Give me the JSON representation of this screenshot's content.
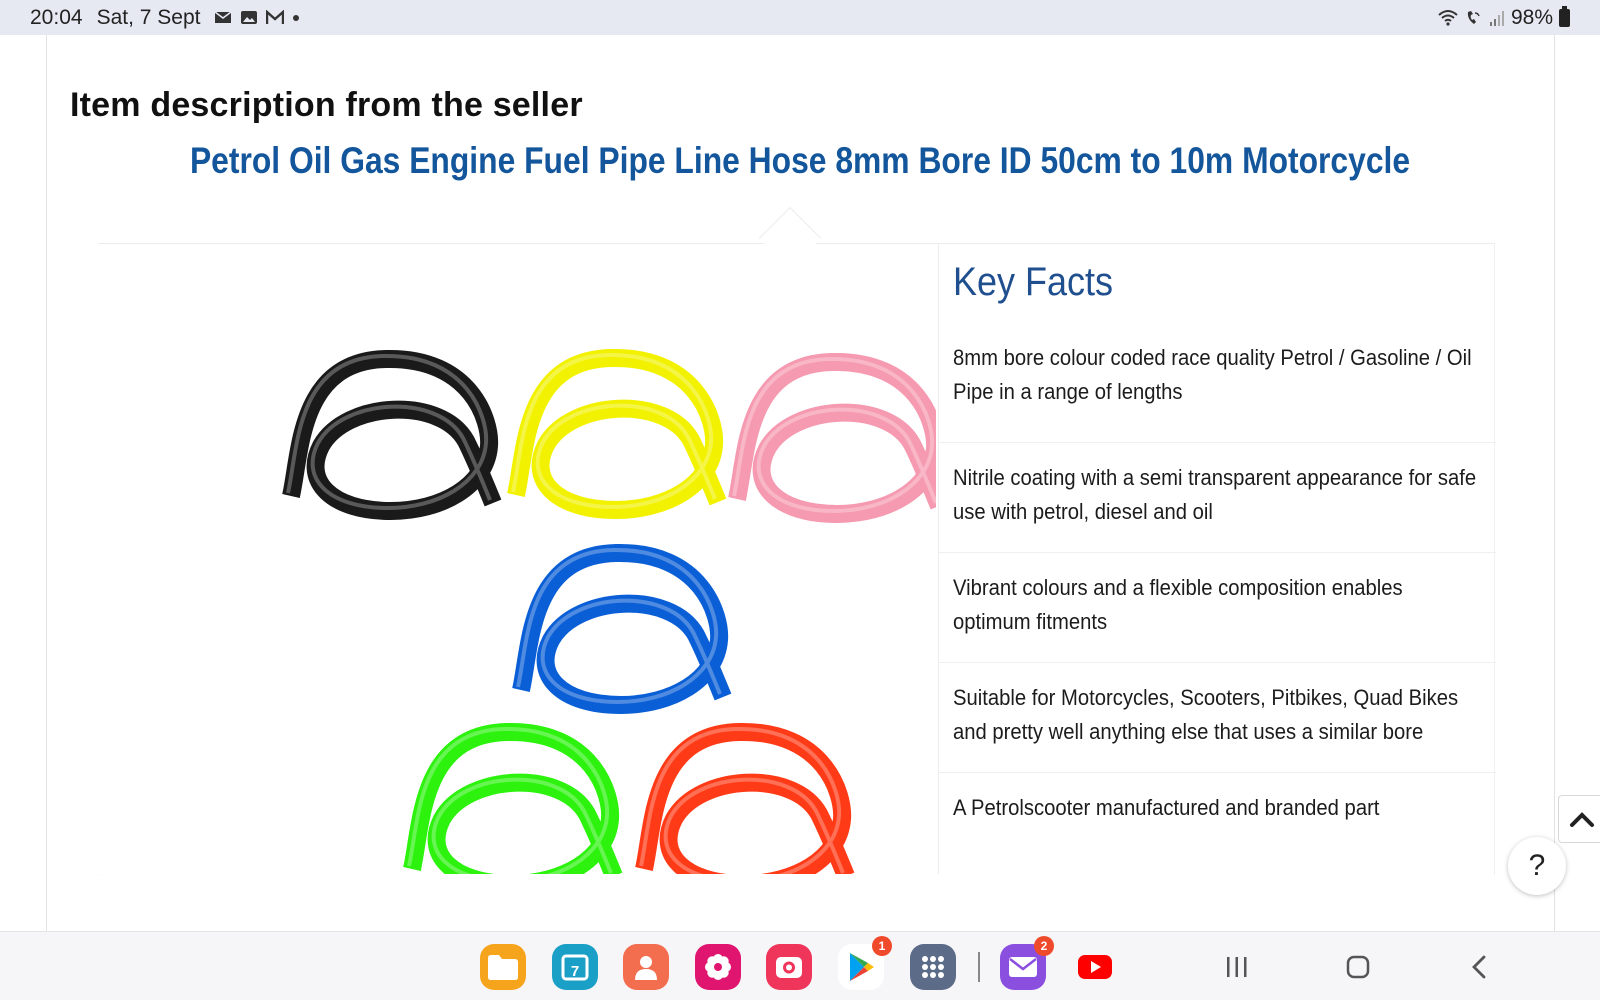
{
  "status_bar": {
    "time": "20:04",
    "date": "Sat, 7 Sept",
    "notification_icons": [
      "email-icon",
      "image-icon",
      "gmail-icon",
      "dot-icon"
    ],
    "battery": "98%",
    "system_icons": [
      "wifi-icon",
      "wifi-call-icon",
      "signal-icon",
      "battery-icon"
    ]
  },
  "page": {
    "section_heading": "Item description from the seller",
    "product_title": "Petrol Oil Gas Engine Fuel Pipe Line Hose 8mm Bore ID 50cm to 10m Motorcycle",
    "product_image": {
      "hose_colors": [
        "#1a1a1a",
        "#f2f200",
        "#f59ab0",
        "#0b5fd6",
        "#2cf20e",
        "#ff3a17"
      ]
    },
    "key_facts": {
      "title": "Key Facts",
      "items": [
        "8mm bore colour coded race quality Petrol / Gasoline / Oil Pipe in a range of lengths",
        "Nitrile coating with a semi transparent appearance for safe use with petrol, diesel and oil",
        "Vibrant colours and a flexible composition enables optimum fitments",
        "Suitable for Motorcycles, Scooters, Pitbikes, Quad Bikes and pretty well anything else that uses a similar bore",
        "A Petrolscooter manufactured and branded part"
      ]
    },
    "help_label": "?"
  },
  "taskbar": {
    "apps": [
      {
        "name": "my-files-icon",
        "color": "#f7a41d"
      },
      {
        "name": "calendar-icon",
        "color": "#1aa0c6",
        "label": "7"
      },
      {
        "name": "contacts-icon",
        "color": "#f36d4f"
      },
      {
        "name": "gallery-icon",
        "color": "#e0156f"
      },
      {
        "name": "screen-recorder-icon",
        "color": "#f0355a"
      },
      {
        "name": "play-store-icon",
        "badge": "1"
      },
      {
        "name": "app-drawer-icon",
        "color": "#5b6b88"
      },
      {
        "name": "email-app-icon",
        "color": "#8b4fe0",
        "badge": "2"
      },
      {
        "name": "youtube-icon",
        "color": "#ff0000"
      }
    ],
    "nav": [
      "recents-icon",
      "home-icon",
      "back-icon"
    ]
  }
}
